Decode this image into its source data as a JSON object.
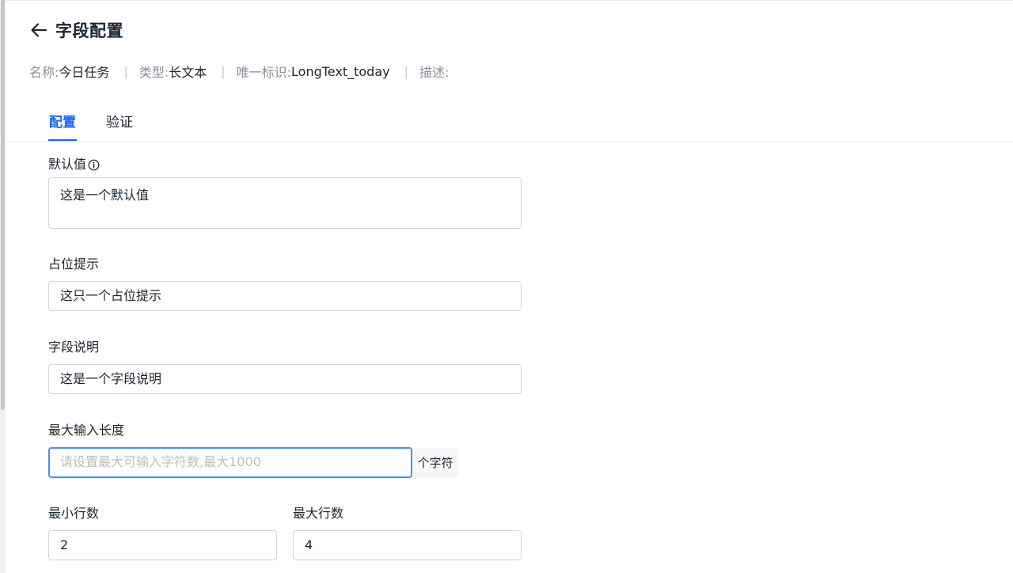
{
  "header": {
    "title": "字段配置",
    "back_icon": "arrow-left-icon"
  },
  "meta": {
    "name_label": "名称:",
    "name_value": "今日任务",
    "type_label": "类型:",
    "type_value": "长文本",
    "id_label": "唯一标识:",
    "id_value": "LongText_today",
    "desc_label": "描述:",
    "separator": "|"
  },
  "tabs": [
    {
      "label": "配置",
      "active": true
    },
    {
      "label": "验证",
      "active": false
    }
  ],
  "form": {
    "default_value": {
      "label": "默认值",
      "value": "这是一个默认值",
      "icon": "info-circle-icon"
    },
    "placeholder_hint": {
      "label": "占位提示",
      "value": "这只一个占位提示"
    },
    "field_description": {
      "label": "字段说明",
      "value": "这是一个字段说明"
    },
    "max_length": {
      "label": "最大输入长度",
      "placeholder": "请设置最大可输入字符数,最大1000",
      "suffix": "个字符"
    },
    "min_rows": {
      "label": "最小行数",
      "value": "2"
    },
    "max_rows": {
      "label": "最大行数",
      "value": "4"
    }
  },
  "colors": {
    "accent": "#1664ff",
    "text": "#1f2329",
    "muted": "#8a8f99",
    "border": "#d0d3d8",
    "focus": "#4b8ef5"
  }
}
